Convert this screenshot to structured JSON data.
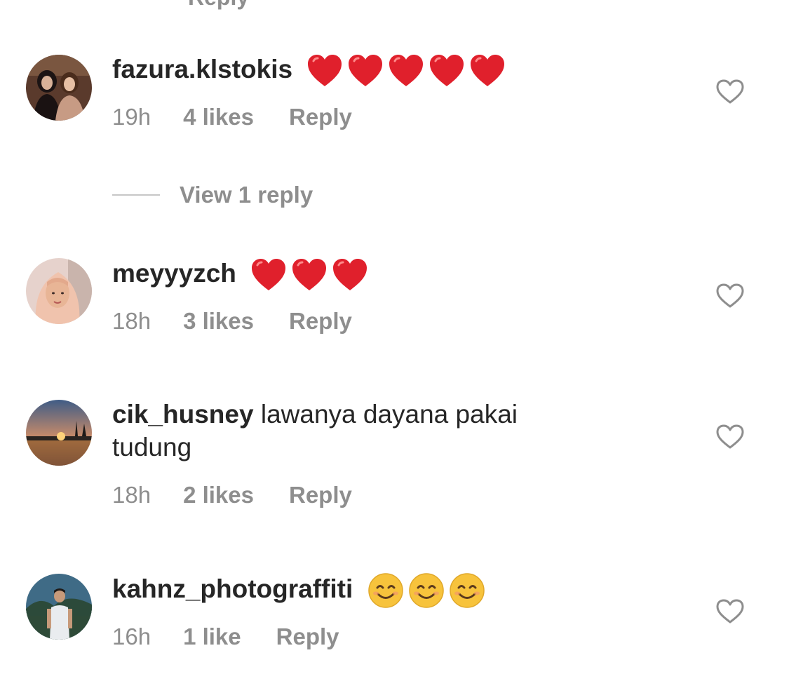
{
  "top_fragment": "Reply",
  "comments": [
    {
      "username": "fazura.klstokis",
      "text": "",
      "emoji": [
        "heart",
        "heart",
        "heart",
        "heart",
        "heart"
      ],
      "time": "19h",
      "likes": "4 likes",
      "reply_label": "Reply",
      "avatar_icon": "avatar-two-women-photo"
    },
    {
      "username": "meyyyzch",
      "text": "",
      "emoji": [
        "heart",
        "heart",
        "heart"
      ],
      "time": "18h",
      "likes": "3 likes",
      "reply_label": "Reply",
      "avatar_icon": "avatar-woman-hijab-photo"
    },
    {
      "username": "cik_husney",
      "text": "lawanya dayana pakai tudung",
      "emoji": [],
      "time": "18h",
      "likes": "2 likes",
      "reply_label": "Reply",
      "avatar_icon": "avatar-sunset-photo"
    },
    {
      "username": "kahnz_photograffiti",
      "text": "",
      "emoji": [
        "smile",
        "smile",
        "smile"
      ],
      "time": "16h",
      "likes": "1 like",
      "reply_label": "Reply",
      "avatar_icon": "avatar-man-photo"
    }
  ],
  "view_replies": {
    "label": "View 1 reply"
  },
  "icons": {
    "like": "heart-outline-icon",
    "heart_emoji": "red-heart-emoji",
    "smile_emoji": "smiling-face-emoji"
  },
  "colors": {
    "text": "#262626",
    "secondary": "#8e8e8e",
    "heart_red": "#e0202c",
    "emoji_yellow": "#f7c33c",
    "divider": "#c7c7c7"
  }
}
